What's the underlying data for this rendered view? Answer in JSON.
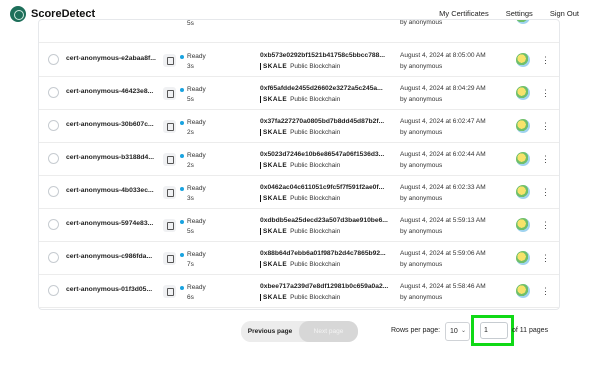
{
  "header": {
    "brand": "ScoreDetect",
    "nav": [
      "My Certificates",
      "Settings",
      "Sign Out"
    ]
  },
  "top_row": {
    "status_secs": "5s",
    "by": "by anonymous"
  },
  "rows": [
    {
      "cert": "cert-anonymous-e2abaa8f...",
      "status": "Ready",
      "secs": "3s",
      "hash": "0xb573e0292bf1521b41758c5bbcc788...",
      "chain": "Public Blockchain",
      "date": "August 4, 2024 at 8:05:00 AM",
      "by": "by anonymous"
    },
    {
      "cert": "cert-anonymous-46423e8...",
      "status": "Ready",
      "secs": "5s",
      "hash": "0xf65afdde2455d26602e3272a5c245a...",
      "chain": "Public Blockchain",
      "date": "August 4, 2024 at 8:04:29 AM",
      "by": "by anonymous"
    },
    {
      "cert": "cert-anonymous-30b607c...",
      "status": "Ready",
      "secs": "2s",
      "hash": "0x37fa227270a0805bd7b8dd45d87b2f...",
      "chain": "Public Blockchain",
      "date": "August 4, 2024 at 6:02:47 AM",
      "by": "by anonymous"
    },
    {
      "cert": "cert-anonymous-b3188d4...",
      "status": "Ready",
      "secs": "2s",
      "hash": "0x5023d7246e10b6e86547a06f1536d3...",
      "chain": "Public Blockchain",
      "date": "August 4, 2024 at 6:02:44 AM",
      "by": "by anonymous"
    },
    {
      "cert": "cert-anonymous-4b033ec...",
      "status": "Ready",
      "secs": "3s",
      "hash": "0x0462ac04c611051c9fc5f7f591f2ae0f...",
      "chain": "Public Blockchain",
      "date": "August 4, 2024 at 6:02:33 AM",
      "by": "by anonymous"
    },
    {
      "cert": "cert-anonymous-5974e83...",
      "status": "Ready",
      "secs": "5s",
      "hash": "0xdbdb5ea25decd23a507d3bae910be6...",
      "chain": "Public Blockchain",
      "date": "August 4, 2024 at 5:59:13 AM",
      "by": "by anonymous"
    },
    {
      "cert": "cert-anonymous-c986fda...",
      "status": "Ready",
      "secs": "7s",
      "hash": "0x88b64d7ebb6a01f987b2d4c7865b92...",
      "chain": "Public Blockchain",
      "date": "August 4, 2024 at 5:59:06 AM",
      "by": "by anonymous"
    },
    {
      "cert": "cert-anonymous-01f3d05...",
      "status": "Ready",
      "secs": "6s",
      "hash": "0xbee717a239d7e8df12981b0c659a0a2...",
      "chain": "Public Blockchain",
      "date": "August 4, 2024 at 5:58:46 AM",
      "by": "by anonymous"
    }
  ],
  "chain_brand": "SKALE",
  "pagination": {
    "prev": "Previous page",
    "next": "Next page",
    "rows_per_page_label": "Rows per page:",
    "rows_per_page_value": "10",
    "current_page": "1",
    "of_pages": "of 11 pages"
  },
  "colors": {
    "status_dot": "#1aa3e0",
    "highlight": "#10d916"
  }
}
